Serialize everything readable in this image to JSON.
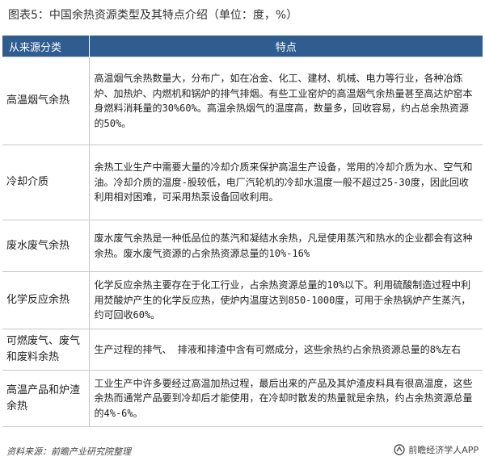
{
  "title": "图表5：中国余热资源类型及其特点介绍（单位：度，%）",
  "table": {
    "headers": [
      "从来源分类",
      "特点"
    ],
    "rows": [
      {
        "category": "高温烟气余热",
        "feature": "高温烟气余热数量大，分布广，如在冶金、化工、建材、机械、电力等行业，各种冶炼炉、加热炉、内燃机和锅炉的排气排烟。有些工业窑炉的高温烟气余热量甚至高达炉窑本身燃料消耗量的30%60%。高温余热烟气的温度高，数量多，回收容易，约占总余热资源的50%。"
      },
      {
        "category": "冷却介质",
        "feature": "余热工业生产中需要大量的冷却介质来保护高温生产设备，常用的冷却介质为水、空气和油。冷却介质的温度-股较低，电厂汽轮机的冷却水温度一般不超过25-30度，因此回收利用相对困难，可采用热泵设备回收利用。"
      },
      {
        "category": "废水废气余热",
        "feature": "废水废气余热是一种低品位的蒸汽和凝结水余热，凡是使用蒸汽和热水的企业都会有这种余热。废水废气资源的占余热资源总量的10%-16%"
      },
      {
        "category": "化学反应余热",
        "feature": "化学反应余热主要存在于化工行业，占余热资源总量的10%以下。利用硫酸制造过程中利用焚酸炉产生的化学反应热，使炉内温度达到850-1000度，可用于余热锅炉产生蒸汽，约可回收60%。"
      },
      {
        "category": "可燃废气、废气和废料余热",
        "feature": "生产过程的排气、 排液和排渣中含有可燃成分，这些余热约占余热资源总量的8%左右"
      },
      {
        "category": "高温产品和炉渣余热",
        "feature": "工业生产中许多要经过高温加热过程，最后出来的产品及其炉渣皮料具有很高温度，这些余热而通常产品要到冷却后才能使用，在冷却时散发的热量就是余热，约占余热资源总量的4%-6%。"
      }
    ]
  },
  "footer": {
    "source": "资料来源：前瞻产业研究院整理",
    "brand": "前瞻经济学人APP",
    "brand_icon": "qianzhan-logo-icon"
  },
  "colors": {
    "header_bg": "#2f5d8f",
    "header_text": "#ffffff",
    "border": "#c7c7c7"
  }
}
